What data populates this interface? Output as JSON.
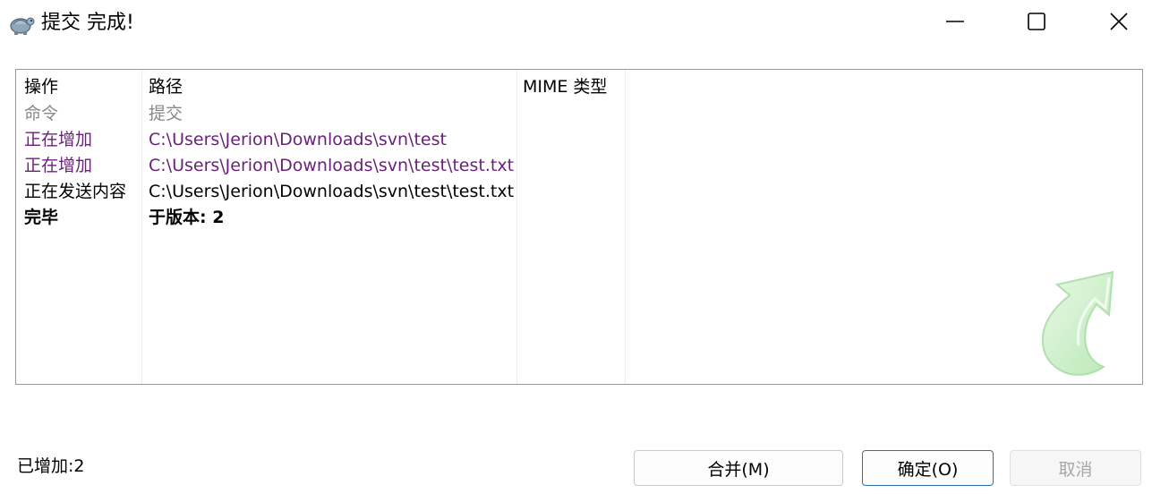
{
  "window": {
    "title": "提交 完成!",
    "icon": "tortoise-svn-icon",
    "controls": {
      "minimize": "minimize-icon",
      "maximize": "maximize-icon",
      "close": "close-icon"
    }
  },
  "log": {
    "columns": [
      "操作",
      "路径",
      "MIME 类型"
    ],
    "rows": [
      {
        "action": "命令",
        "path": "提交",
        "style": "gray"
      },
      {
        "action": "正在增加",
        "path": "C:\\Users\\Jerion\\Downloads\\svn\\test",
        "style": "purple"
      },
      {
        "action": "正在增加",
        "path": "C:\\Users\\Jerion\\Downloads\\svn\\test\\test.txt",
        "style": "purple"
      },
      {
        "action": "正在发送内容",
        "path": "C:\\Users\\Jerion\\Downloads\\svn\\test\\test.txt",
        "style": "normal"
      },
      {
        "action": "完毕",
        "path": "于版本: 2",
        "style": "bold"
      }
    ],
    "watermark_icon": "commit-arrow-icon"
  },
  "status": {
    "text": "已增加:2"
  },
  "buttons": {
    "merge": "合并(M)",
    "ok": "确定(O)",
    "cancel": "取消"
  },
  "colors": {
    "purple_row": "#6a1f7a",
    "gray_row": "#888888",
    "ok_border": "#2f6fb0",
    "watermark_green": "#b9e9b6"
  }
}
